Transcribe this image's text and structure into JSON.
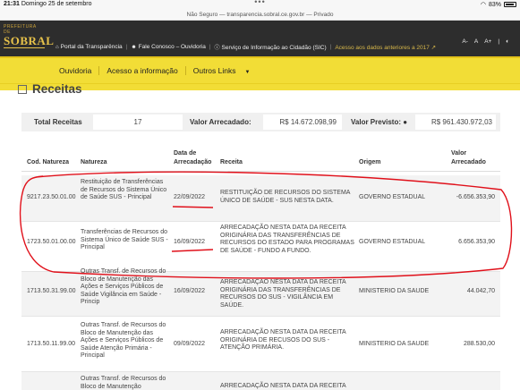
{
  "status_bar": {
    "time": "21:31",
    "date": "Domingo 25 de setembro",
    "battery": "83%"
  },
  "browser": {
    "url_text": "Não Seguro — transparencia.sobral.ce.gov.br — Privado"
  },
  "header": {
    "logo_small": "PREFEITURA DE",
    "logo_main": "SOBRAL",
    "links": {
      "portal": "Portal da Transparência",
      "fale": "Fale Conosco – Ouvidoria",
      "sic": "Serviço de Informação ao Cidadão (SIC)",
      "old": "Acesso aos dados anteriores a 2017"
    },
    "accessibility": {
      "a_minus": "A-",
      "a": "A",
      "a_plus": "A+"
    }
  },
  "nav": {
    "items": [
      "Ouvidoria",
      "Acesso a informação",
      "Outros Links"
    ]
  },
  "page": {
    "title": "Receitas"
  },
  "summary": {
    "total_label": "Total Receitas",
    "total_value": "17",
    "arrecadado_label": "Valor Arrecadado:",
    "arrecadado_value": "R$ 14.672.098,99",
    "previsto_label": "Valor Previsto:",
    "previsto_value": "R$ 961.430.972,03"
  },
  "table": {
    "headers": {
      "cod": "Cod. Natureza",
      "natureza": "Natureza",
      "data": "Data de Arrecadação",
      "receita": "Receita",
      "origem": "Origem",
      "valor": "Valor Arrecadado"
    },
    "rows": [
      {
        "cod": "9217.23.50.01.00",
        "natureza": "Restituição de Transferências de Recursos do Sistema Único de Saúde  SUS - Principal",
        "data": "22/09/2022",
        "receita": "RESTITUIÇÃO DE RECURSOS DO SISTEMA ÚNICO DE SAÚDE - SUS NESTA DATA.",
        "origem": "GOVERNO ESTADUAL",
        "valor": "-6.656.353,90"
      },
      {
        "cod": "1723.50.01.00.00",
        "natureza": "Transferências de Recursos do Sistema Único de Saúde  SUS - Principal",
        "data": "16/09/2022",
        "receita": "ARRECADAÇÃO NESTA DATA DA RECEITA ORIGINÁRIA DAS TRANSFERÊNCIAS DE RECURSOS DO ESTADO PARA PROGRAMAS DE SAÚDE - FUNDO A FUNDO.",
        "origem": "GOVERNO ESTADUAL",
        "valor": "6.656.353,90"
      },
      {
        "cod": "1713.50.31.99.00",
        "natureza": "Outras Transf. de Recursos do Bloco de Manutenção das Ações e Serviços Públicos de Saúde  Vigilância em Saúde - Princip",
        "data": "16/09/2022",
        "receita": "ARRECADAÇÃO NESTA DATA DA RECEITA ORIGINÁRIA DAS TRANSFERÊNCIAS DE RECURSOS DO SUS - VIGILÂNCIA EM SAÚDE.",
        "origem": "MINISTERIO DA SAUDE",
        "valor": "44.042,70"
      },
      {
        "cod": "1713.50.11.99.00",
        "natureza": "Outras Transf. de Recursos do Bloco de Manutenção das Ações e Serviços Públicos de Saúde  Atenção Primária - Principal",
        "data": "09/09/2022",
        "receita": "ARRECADAÇÃO NESTA DATA DA RECEITA ORIGINÁRIA DE RECUSOS DO SUS - ATENÇÃO PRIMÁRIA.",
        "origem": "MINISTERIO DA SAUDE",
        "valor": "288.530,00"
      },
      {
        "cod": "",
        "natureza": "Outras Transf. de Recursos do Bloco de Manutenção",
        "data": "",
        "receita": "ARRECADAÇÃO NESTA DATA DA RECEITA",
        "origem": "",
        "valor": ""
      }
    ]
  },
  "colors": {
    "nav_yellow": "#f2dd36",
    "header_dark": "#2d2d2d",
    "annotation_red": "#e0101a"
  }
}
